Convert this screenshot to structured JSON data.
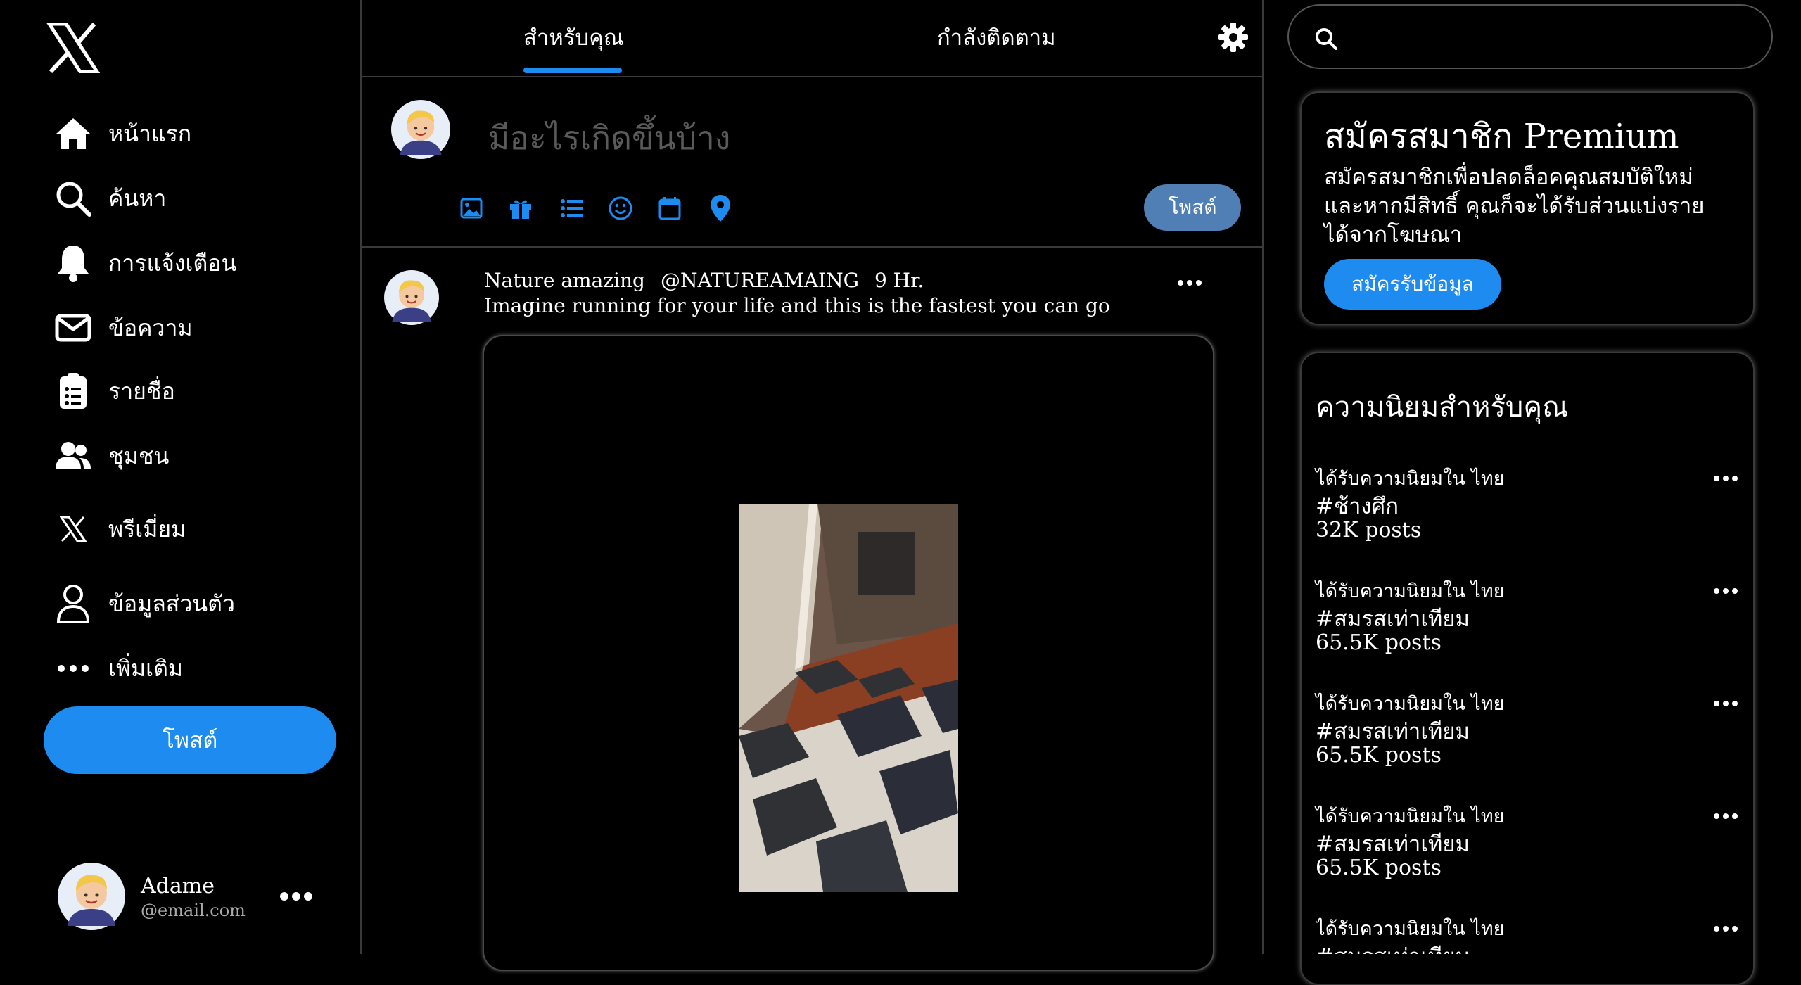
{
  "sidebar": {
    "logo": "x-logo",
    "items": [
      {
        "label": "หน้าแรก",
        "icon": "home-icon"
      },
      {
        "label": "ค้นหา",
        "icon": "search-icon"
      },
      {
        "label": "การแจ้งเตือน",
        "icon": "bell-icon"
      },
      {
        "label": "ข้อความ",
        "icon": "mail-icon"
      },
      {
        "label": "รายชื่อ",
        "icon": "list-clipboard-icon"
      },
      {
        "label": "ชุมชน",
        "icon": "people-icon"
      },
      {
        "label": "พรีเมี่ยม",
        "icon": "x-logo-icon"
      },
      {
        "label": "ข้อมูลส่วนตัว",
        "icon": "user-icon"
      },
      {
        "label": "เพิ่มเติม",
        "icon": "more-dots-icon"
      }
    ],
    "post_button": "โพสต์",
    "profile": {
      "name": "Adame",
      "email": "@email.com"
    }
  },
  "tabs": [
    {
      "label": "สำหรับคุณ",
      "active": true
    },
    {
      "label": "กำลังติดตาม",
      "active": false
    }
  ],
  "composer": {
    "placeholder": "มีอะไรเกิดขึ้นบ้าง",
    "post_button": "โพสต์",
    "tools": [
      "image-icon",
      "gif-icon",
      "poll-list-icon",
      "emoji-icon",
      "schedule-icon",
      "location-icon"
    ]
  },
  "post": {
    "author": "Nature amazing",
    "handle": "@NATUREAMAING",
    "time": "9 Hr.",
    "text": "Imagine running for your life and this is the fastest you can go"
  },
  "premium": {
    "title": "สมัครสมาชิก Premium",
    "description": "สมัครสมาชิกเพื่อปลดล็อคคุณสมบัติใหม่ และหากมีสิทธิ์ คุณก็จะได้รับส่วนแบ่งรายได้จากโฆษณา",
    "button": "สมัครรับข้อมูล"
  },
  "trends": {
    "title": "ความนิยมสำหรับคุณ",
    "items": [
      {
        "context": "ได้รับความนิยมใน ไทย",
        "tag": "#ช้างศึก",
        "count": "32K posts"
      },
      {
        "context": "ได้รับความนิยมใน ไทย",
        "tag": "#สมรสเท่าเทียม",
        "count": "65.5K posts"
      },
      {
        "context": "ได้รับความนิยมใน ไทย",
        "tag": "#สมรสเท่าเทียม",
        "count": "65.5K posts"
      },
      {
        "context": "ได้รับความนิยมใน ไทย",
        "tag": "#สมรสเท่าเทียม",
        "count": "65.5K posts"
      },
      {
        "context": "ได้รับความนิยมใน ไทย",
        "tag": "#สมรสเท่าเทียม",
        "count": ""
      }
    ]
  },
  "colors": {
    "accent": "#1d8bf0",
    "background": "#000000",
    "divider": "#3a3a3a"
  }
}
